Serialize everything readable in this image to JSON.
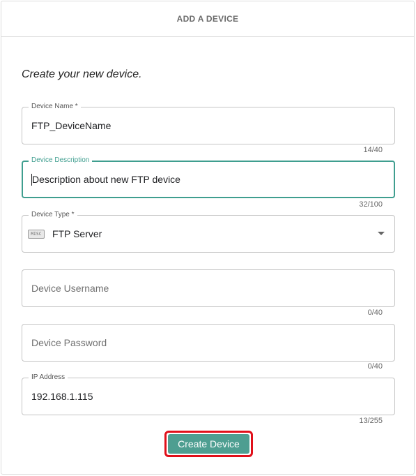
{
  "header": {
    "title": "ADD A DEVICE"
  },
  "subtitle": "Create your new device.",
  "fields": {
    "name": {
      "label": "Device Name *",
      "value": "FTP_DeviceName",
      "counter": "14/40"
    },
    "description": {
      "label": "Device Description",
      "value": "Description about new FTP device",
      "counter": "32/100"
    },
    "type": {
      "label": "Device Type *",
      "value": "FTP Server",
      "icon_text": "MISC",
      "icon": "misc-chip-icon"
    },
    "username": {
      "placeholder": "Device Username",
      "value": "",
      "counter": "0/40"
    },
    "password": {
      "placeholder": "Device Password",
      "value": "",
      "counter": "0/40"
    },
    "ip": {
      "label": "IP Address",
      "value": "192.168.1.115",
      "counter": "13/255"
    }
  },
  "actions": {
    "create_label": "Create Device"
  },
  "colors": {
    "accent": "#4e9e91",
    "focus": "#3f9e8f",
    "highlight_border": "#e0101a"
  }
}
